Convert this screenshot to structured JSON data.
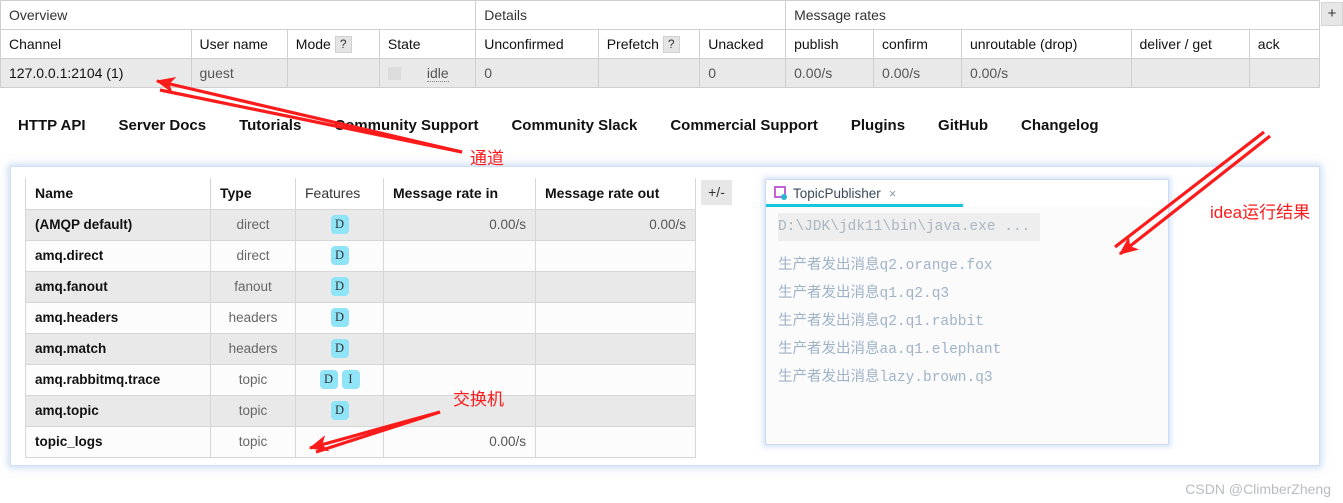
{
  "channels": {
    "group_headers": [
      {
        "label": "Overview",
        "span": 4
      },
      {
        "label": "Details",
        "span": 3
      },
      {
        "label": "Message rates",
        "span": 5
      }
    ],
    "columns": [
      {
        "label": "Channel",
        "bold": true
      },
      {
        "label": "User name",
        "bold": true
      },
      {
        "label": "Mode",
        "bold": false,
        "help": "?"
      },
      {
        "label": "State",
        "bold": true
      },
      {
        "label": "Unconfirmed",
        "bold": true
      },
      {
        "label": "Prefetch",
        "bold": false,
        "help": "?"
      },
      {
        "label": "Unacked",
        "bold": true
      },
      {
        "label": "publish",
        "bold": true
      },
      {
        "label": "confirm",
        "bold": true
      },
      {
        "label": "unroutable (drop)",
        "bold": true
      },
      {
        "label": "deliver / get",
        "bold": true
      },
      {
        "label": "ack",
        "bold": true
      }
    ],
    "row": {
      "channel": "127.0.0.1:2104 (1)",
      "user_name": "guest",
      "mode": "",
      "state": "idle",
      "unconfirmed": "0",
      "prefetch": "",
      "unacked": "0",
      "publish": "0.00/s",
      "confirm": "0.00/s",
      "unroutable_drop": "0.00/s",
      "deliver_get": "",
      "ack": ""
    },
    "plus_minus": "+/-"
  },
  "nav": {
    "links": [
      "HTTP API",
      "Server Docs",
      "Tutorials",
      "Community Support",
      "Community Slack",
      "Commercial Support",
      "Plugins",
      "GitHub",
      "Changelog"
    ]
  },
  "exchanges": {
    "columns": [
      "Name",
      "Type",
      "Features",
      "Message rate in",
      "Message rate out"
    ],
    "plus_minus": "+/-",
    "rows": [
      {
        "name": "(AMQP default)",
        "type": "direct",
        "features": [
          "D"
        ],
        "rate_in": "0.00/s",
        "rate_out": "0.00/s"
      },
      {
        "name": "amq.direct",
        "type": "direct",
        "features": [
          "D"
        ],
        "rate_in": "",
        "rate_out": ""
      },
      {
        "name": "amq.fanout",
        "type": "fanout",
        "features": [
          "D"
        ],
        "rate_in": "",
        "rate_out": ""
      },
      {
        "name": "amq.headers",
        "type": "headers",
        "features": [
          "D"
        ],
        "rate_in": "",
        "rate_out": ""
      },
      {
        "name": "amq.match",
        "type": "headers",
        "features": [
          "D"
        ],
        "rate_in": "",
        "rate_out": ""
      },
      {
        "name": "amq.rabbitmq.trace",
        "type": "topic",
        "features": [
          "D",
          "I"
        ],
        "rate_in": "",
        "rate_out": ""
      },
      {
        "name": "amq.topic",
        "type": "topic",
        "features": [
          "D"
        ],
        "rate_in": "",
        "rate_out": ""
      },
      {
        "name": "topic_logs",
        "type": "topic",
        "features": [],
        "rate_in": "0.00/s",
        "rate_out": ""
      }
    ]
  },
  "ide": {
    "tab_label": "TopicPublisher",
    "tab_close": "×",
    "console_lines": [
      {
        "text": "D:\\JDK\\jdk11\\bin\\java.exe ...",
        "kind": "command"
      },
      {
        "text": "生产者发出消息q2.orange.fox",
        "kind": "output"
      },
      {
        "text": "生产者发出消息q1.q2.q3",
        "kind": "output"
      },
      {
        "text": "生产者发出消息q2.q1.rabbit",
        "kind": "output"
      },
      {
        "text": "生产者发出消息aa.q1.elephant",
        "kind": "output"
      },
      {
        "text": "生产者发出消息lazy.brown.q3",
        "kind": "output"
      }
    ]
  },
  "annotations": {
    "channel_label": "通道",
    "exchange_label": "交换机",
    "idea_label": "idea运行结果",
    "color": "#fb1b1b"
  },
  "watermark": "CSDN @ClimberZheng",
  "colors": {
    "feature_badge": "#8fe4f7",
    "ide_tab_underline": "#17c5dc",
    "annotation_red": "#fb1b1b",
    "panel_glow": "#a0c3eb"
  }
}
